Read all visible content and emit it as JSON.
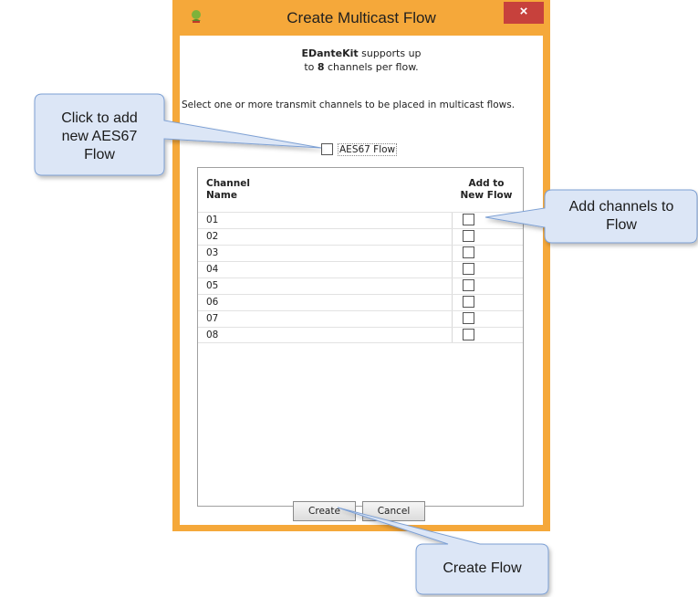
{
  "window": {
    "title": "Create Multicast Flow",
    "close_label": "×"
  },
  "info": {
    "app_name": "EDanteKit",
    "line1_rest": " supports up",
    "line2_pre": "to ",
    "max_channels": "8",
    "line2_rest": " channels per flow."
  },
  "prompt": "Select one or more transmit channels to be placed in multicast flows.",
  "aes67": {
    "label": "AES67 Flow",
    "checked": false
  },
  "table": {
    "col_name_line1": "Channel",
    "col_name_line2": "Name",
    "col_add_line1": "Add to",
    "col_add_line2": "New Flow",
    "rows": [
      {
        "name": "01",
        "checked": false
      },
      {
        "name": "02",
        "checked": false
      },
      {
        "name": "03",
        "checked": false
      },
      {
        "name": "04",
        "checked": false
      },
      {
        "name": "05",
        "checked": false
      },
      {
        "name": "06",
        "checked": false
      },
      {
        "name": "07",
        "checked": false
      },
      {
        "name": "08",
        "checked": false
      }
    ]
  },
  "buttons": {
    "create": "Create",
    "cancel": "Cancel"
  },
  "callouts": {
    "aes67_line1": "Click to add",
    "aes67_line2": "new AES67",
    "aes67_line3": "Flow",
    "channels_line1": "Add channels to",
    "channels_line2": "Flow",
    "create": "Create Flow"
  },
  "colors": {
    "window_border": "#f5a83a",
    "close_button": "#c7413c",
    "callout_fill": "#dce6f6",
    "callout_stroke": "#7da0d4"
  }
}
